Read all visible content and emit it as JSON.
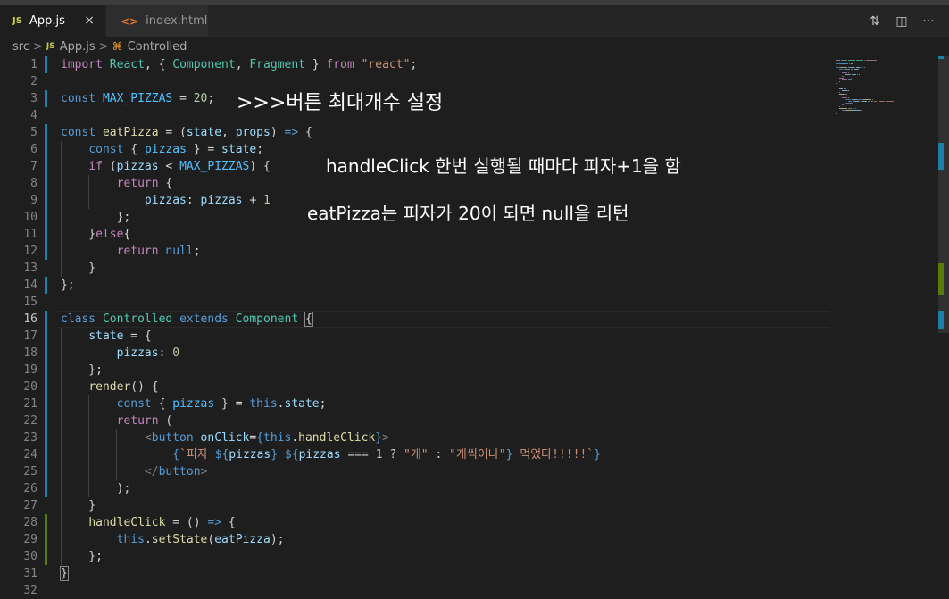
{
  "tabs": [
    {
      "badge": "JS",
      "label": "App.js",
      "close": "×",
      "active": true
    },
    {
      "badge": "<>",
      "label": "index.html",
      "active": false
    }
  ],
  "toolbar_icons": [
    "source-control-compare-icon",
    "split-editor-icon",
    "more-actions-icon"
  ],
  "toolbar_glyphs": [
    "⇅",
    "◫",
    "···"
  ],
  "breadcrumb": {
    "items": [
      "src",
      "App.js",
      "Controlled"
    ],
    "separator": ">",
    "file_badge": "JS",
    "symbol_glyph": "⌘"
  },
  "line_numbers": [
    "1",
    "2",
    "3",
    "4",
    "5",
    "6",
    "7",
    "8",
    "9",
    "10",
    "11",
    "12",
    "13",
    "14",
    "15",
    "16",
    "17",
    "18",
    "19",
    "20",
    "21",
    "22",
    "23",
    "24",
    "25",
    "26",
    "27",
    "28",
    "29",
    "30",
    "31",
    "32"
  ],
  "annotations": [
    ">>>버튼 최대개수 설정",
    "handleClick 한번 실행될 때마다 피자+1을 함",
    "eatPizza는 피자가 20이 되면 null을 리턴"
  ],
  "colors": {
    "background": "#1e1e1e",
    "modified_blue": "#1b81a8",
    "added_green": "#587c0c",
    "keyword": "#569cd6",
    "control": "#c586c0",
    "class": "#4ec9b0",
    "string": "#ce9178",
    "number": "#b5cea8"
  },
  "code_lines": [
    [
      [
        "kc",
        "import"
      ],
      [
        "pl",
        " "
      ],
      [
        "cls",
        "React"
      ],
      [
        "pl",
        ", { "
      ],
      [
        "cls",
        "Component"
      ],
      [
        "pl",
        ", "
      ],
      [
        "cls",
        "Fragment"
      ],
      [
        "pl",
        " } "
      ],
      [
        "kc",
        "from"
      ],
      [
        "pl",
        " "
      ],
      [
        "str",
        "\"react\""
      ],
      [
        "pl",
        ";"
      ]
    ],
    [],
    [
      [
        "kw",
        "const"
      ],
      [
        "pl",
        " "
      ],
      [
        "cst",
        "MAX_PIZZAS"
      ],
      [
        "pl",
        " = "
      ],
      [
        "num",
        "20"
      ],
      [
        "pl",
        ";"
      ]
    ],
    [],
    [
      [
        "kw",
        "const"
      ],
      [
        "pl",
        " "
      ],
      [
        "fn",
        "eatPizza"
      ],
      [
        "pl",
        " = ("
      ],
      [
        "var",
        "state"
      ],
      [
        "pl",
        ", "
      ],
      [
        "var",
        "props"
      ],
      [
        "pl",
        ") "
      ],
      [
        "kw",
        "=>"
      ],
      [
        "pl",
        " {"
      ]
    ],
    [
      [
        "pl",
        "    "
      ],
      [
        "kw",
        "const"
      ],
      [
        "pl",
        " { "
      ],
      [
        "cst",
        "pizzas"
      ],
      [
        "pl",
        " } = "
      ],
      [
        "var",
        "state"
      ],
      [
        "pl",
        ";"
      ]
    ],
    [
      [
        "pl",
        "    "
      ],
      [
        "kc",
        "if"
      ],
      [
        "pl",
        " ("
      ],
      [
        "var",
        "pizzas"
      ],
      [
        "pl",
        " < "
      ],
      [
        "cst",
        "MAX_PIZZAS"
      ],
      [
        "pl",
        ") {"
      ]
    ],
    [
      [
        "pl",
        "        "
      ],
      [
        "kc",
        "return"
      ],
      [
        "pl",
        " {"
      ]
    ],
    [
      [
        "pl",
        "            "
      ],
      [
        "var",
        "pizzas"
      ],
      [
        "pl",
        ": "
      ],
      [
        "var",
        "pizzas"
      ],
      [
        "pl",
        " + "
      ],
      [
        "num",
        "1"
      ]
    ],
    [
      [
        "pl",
        "        };"
      ]
    ],
    [
      [
        "pl",
        "    }"
      ],
      [
        "kc",
        "else"
      ],
      [
        "pl",
        "{"
      ]
    ],
    [
      [
        "pl",
        "        "
      ],
      [
        "kc",
        "return"
      ],
      [
        "pl",
        " "
      ],
      [
        "kw",
        "null"
      ],
      [
        "pl",
        ";"
      ]
    ],
    [
      [
        "pl",
        "    }"
      ]
    ],
    [
      [
        "pl",
        "};"
      ]
    ],
    [],
    [
      [
        "kw",
        "class"
      ],
      [
        "pl",
        " "
      ],
      [
        "cls",
        "Controlled"
      ],
      [
        "pl",
        " "
      ],
      [
        "kw",
        "extends"
      ],
      [
        "pl",
        " "
      ],
      [
        "cls",
        "Component"
      ],
      [
        "pl",
        " "
      ],
      [
        "brk",
        "{"
      ]
    ],
    [
      [
        "pl",
        "    "
      ],
      [
        "var",
        "state"
      ],
      [
        "pl",
        " = {"
      ]
    ],
    [
      [
        "pl",
        "        "
      ],
      [
        "var",
        "pizzas"
      ],
      [
        "pl",
        ": "
      ],
      [
        "num",
        "0"
      ]
    ],
    [
      [
        "pl",
        "    };"
      ]
    ],
    [
      [
        "pl",
        "    "
      ],
      [
        "fn",
        "render"
      ],
      [
        "pl",
        "() {"
      ]
    ],
    [
      [
        "pl",
        "        "
      ],
      [
        "kw",
        "const"
      ],
      [
        "pl",
        " { "
      ],
      [
        "cst",
        "pizzas"
      ],
      [
        "pl",
        " } = "
      ],
      [
        "kw",
        "this"
      ],
      [
        "pl",
        "."
      ],
      [
        "var",
        "state"
      ],
      [
        "pl",
        ";"
      ]
    ],
    [
      [
        "pl",
        "        "
      ],
      [
        "kc",
        "return"
      ],
      [
        "pl",
        " ("
      ]
    ],
    [
      [
        "pl",
        "            "
      ],
      [
        "ang",
        "<"
      ],
      [
        "tag",
        "button"
      ],
      [
        "pl",
        " "
      ],
      [
        "var",
        "onClick"
      ],
      [
        "pl",
        "="
      ],
      [
        "kw",
        "{"
      ],
      [
        "kw",
        "this"
      ],
      [
        "pl",
        "."
      ],
      [
        "fn",
        "handleClick"
      ],
      [
        "kw",
        "}"
      ],
      [
        "ang",
        ">"
      ]
    ],
    [
      [
        "pl",
        "                "
      ],
      [
        "kw",
        "{"
      ],
      [
        "str",
        "`피자 "
      ],
      [
        "kw",
        "${"
      ],
      [
        "var",
        "pizzas"
      ],
      [
        "kw",
        "}"
      ],
      [
        "str",
        " "
      ],
      [
        "kw",
        "${"
      ],
      [
        "var",
        "pizzas"
      ],
      [
        "pl",
        " === "
      ],
      [
        "num",
        "1"
      ],
      [
        "pl",
        " ? "
      ],
      [
        "str",
        "\"개\""
      ],
      [
        "pl",
        " : "
      ],
      [
        "str",
        "\"개씩이나\""
      ],
      [
        "kw",
        "}"
      ],
      [
        "str",
        " 먹었다!!!!!`"
      ],
      [
        "kw",
        "}"
      ]
    ],
    [
      [
        "pl",
        "            "
      ],
      [
        "ang",
        "</"
      ],
      [
        "tag",
        "button"
      ],
      [
        "ang",
        ">"
      ]
    ],
    [
      [
        "pl",
        "        );"
      ]
    ],
    [
      [
        "pl",
        "    }"
      ]
    ],
    [
      [
        "pl",
        "    "
      ],
      [
        "fn",
        "handleClick"
      ],
      [
        "pl",
        " = () "
      ],
      [
        "kw",
        "=>"
      ],
      [
        "pl",
        " {"
      ]
    ],
    [
      [
        "pl",
        "        "
      ],
      [
        "kw",
        "this"
      ],
      [
        "pl",
        "."
      ],
      [
        "fn",
        "setState"
      ],
      [
        "pl",
        "("
      ],
      [
        "var",
        "eatPizza"
      ],
      [
        "pl",
        ");"
      ]
    ],
    [
      [
        "pl",
        "    };"
      ]
    ],
    [
      [
        "brk",
        "}"
      ]
    ],
    []
  ]
}
